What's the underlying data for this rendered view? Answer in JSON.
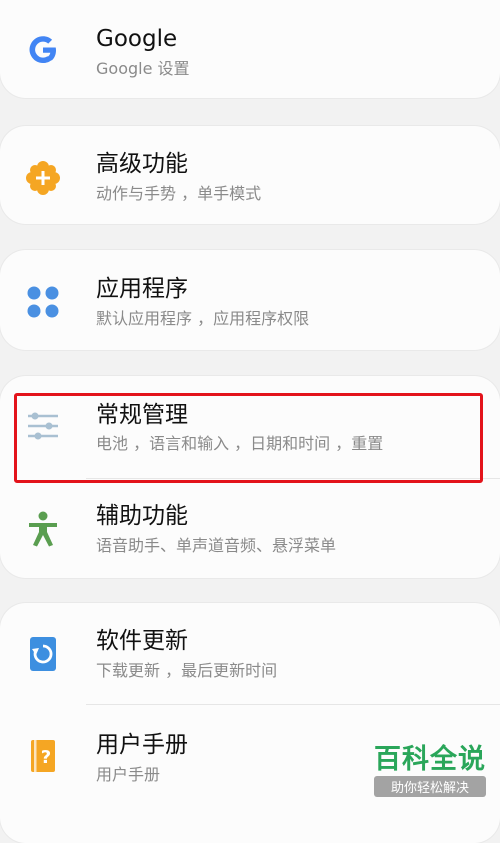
{
  "settings": {
    "items": [
      {
        "title": "Google",
        "subtitle": "Google 设置",
        "icon": "google-icon"
      },
      {
        "title": "高级功能",
        "subtitle": "动作与手势 ，单手模式",
        "icon": "advanced-features-icon"
      },
      {
        "title": "应用程序",
        "subtitle": "默认应用程序 ，应用程序权限",
        "icon": "apps-icon"
      },
      {
        "title": "常规管理",
        "subtitle": "电池 ，语言和输入 ，日期和时间 ，重置",
        "icon": "sliders-icon"
      },
      {
        "title": "辅助功能",
        "subtitle": "语音助手、单声道音频、悬浮菜单",
        "icon": "accessibility-icon"
      },
      {
        "title": "软件更新",
        "subtitle": "下载更新 ，最后更新时间",
        "icon": "software-update-icon"
      },
      {
        "title": "用户手册",
        "subtitle": "用户手册",
        "icon": "user-manual-icon"
      }
    ]
  },
  "watermark": {
    "main": "百科全说",
    "sub": "助你轻松解决"
  },
  "colors": {
    "google_blue": "#4285f4",
    "orange": "#f5a623",
    "blue": "#4a90e2",
    "green": "#5a9e50",
    "highlight_red": "#e3131b"
  }
}
